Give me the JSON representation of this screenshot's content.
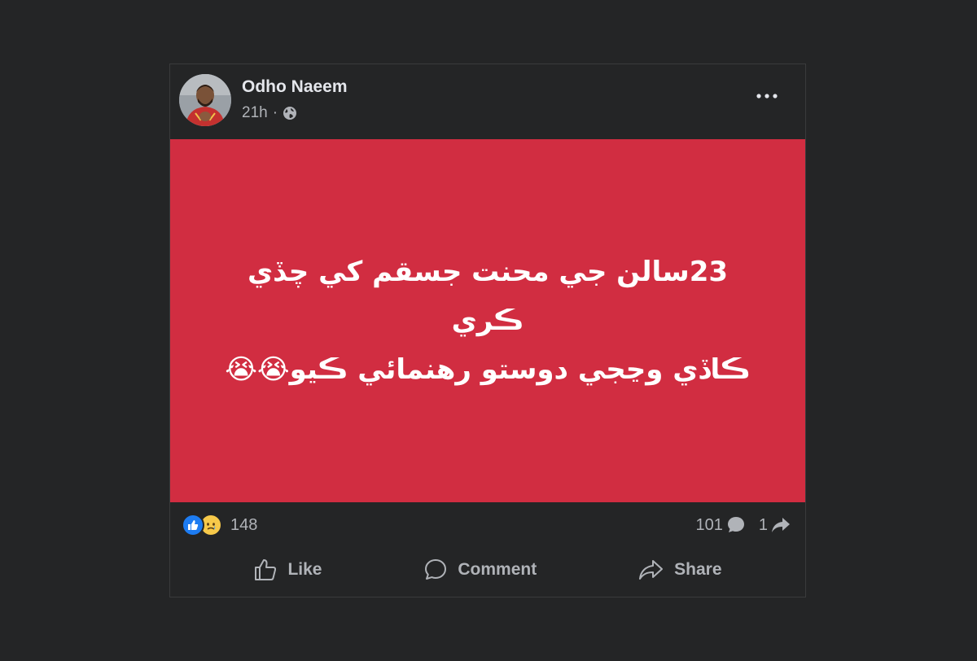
{
  "post": {
    "author": "Odho Naeem",
    "time": "21h",
    "separator": "·",
    "audience_icon": "globe-icon",
    "more_icon": "more-options-icon",
    "media": {
      "background": "#d12d41",
      "line1": "23سالن جي محنت جسقم کي چڏي ڪري",
      "line2": "ڪاڏي وڃجي دوستو رهنمائي ڪيو",
      "emoji": "😭😭"
    },
    "reactions": {
      "icons": [
        "like-icon",
        "sad-icon"
      ],
      "count": "148"
    },
    "comments": {
      "count": "101",
      "icon": "comment-icon"
    },
    "shares": {
      "count": "1",
      "icon": "share-icon"
    },
    "actions": {
      "like": "Like",
      "comment": "Comment",
      "share": "Share"
    }
  },
  "colors": {
    "background": "#242526",
    "text_primary": "#e4e6eb",
    "text_secondary": "#b0b3b8",
    "like_blue": "#1d7cf2",
    "media_red": "#d12d41"
  }
}
